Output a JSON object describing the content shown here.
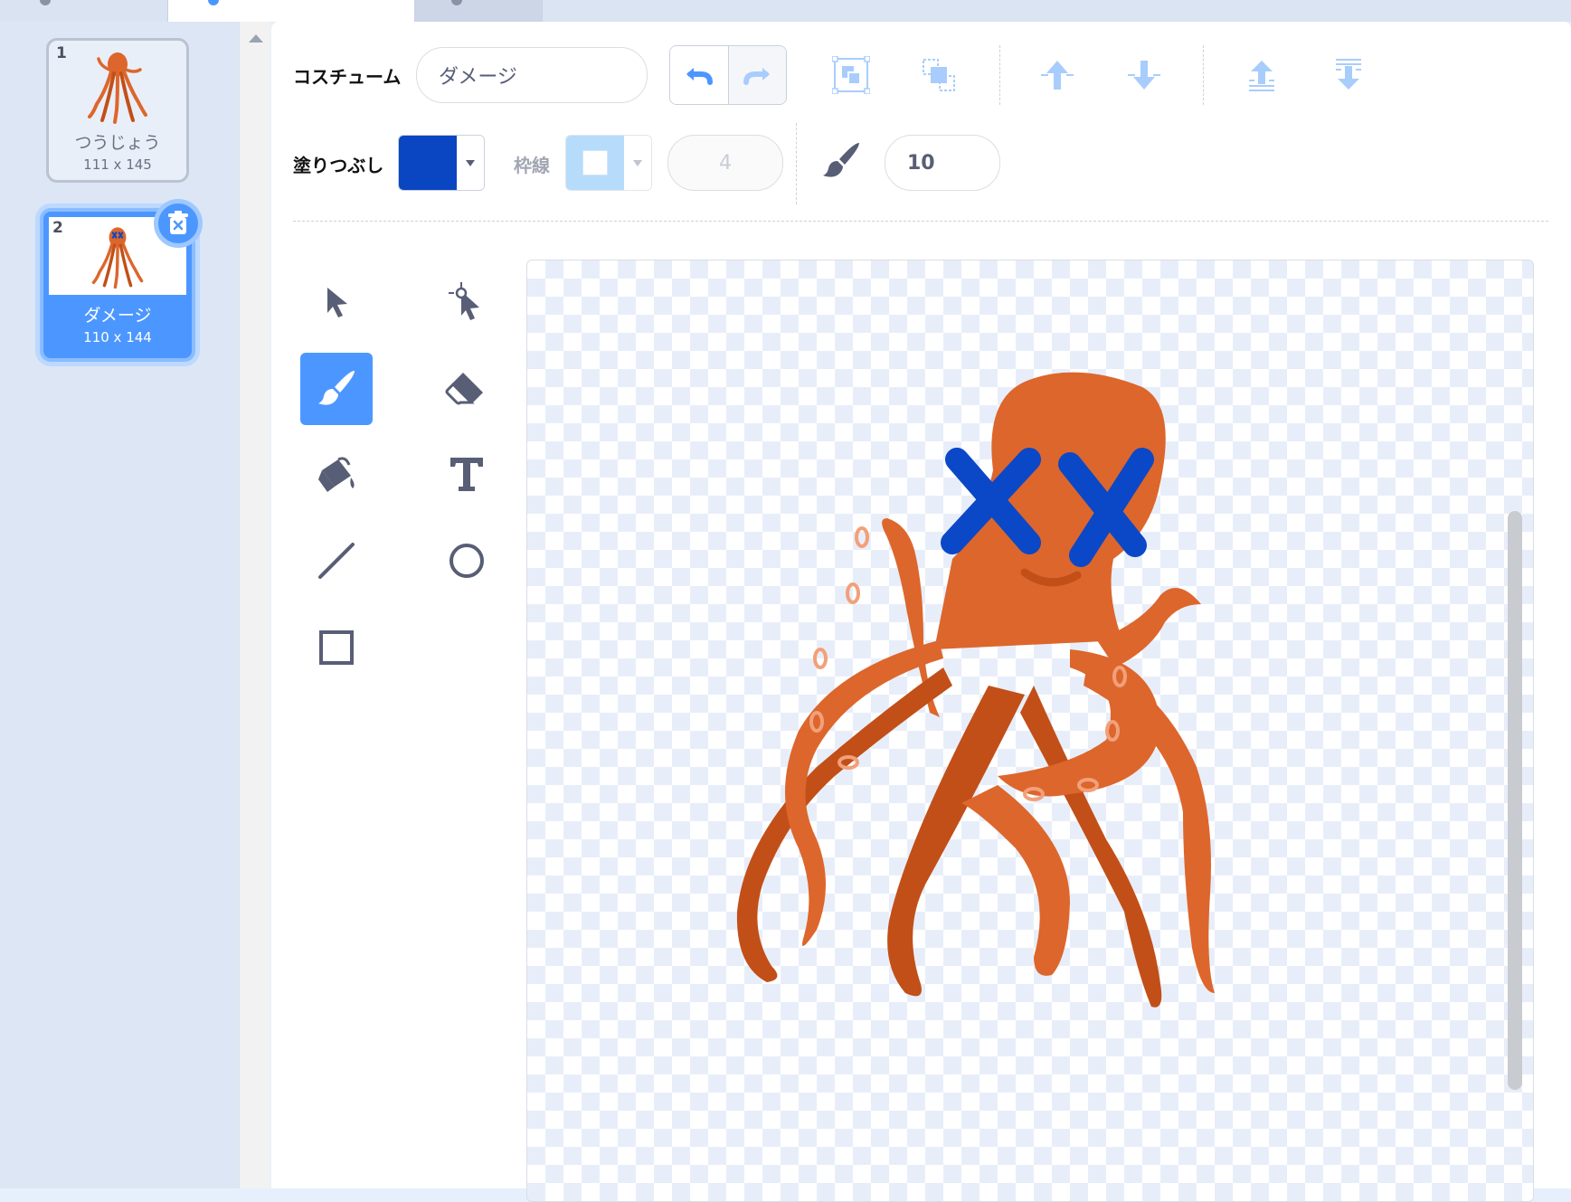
{
  "costumes": [
    {
      "number": "1",
      "name": "つうじょう",
      "size": "111 x 145"
    },
    {
      "number": "2",
      "name": "ダメージ",
      "size": "110 x 144"
    }
  ],
  "toolbar": {
    "costume_label": "コスチューム",
    "costume_name": "ダメージ",
    "fill_label": "塗りつぶし",
    "outline_label": "枠線",
    "outline_width": "4",
    "brush_size": "10"
  },
  "colors": {
    "fill": "#0b46c2",
    "outline": "#ffffff",
    "accent": "#4c97ff",
    "octopus": "#dd662c",
    "octopus_dark": "#c24f18",
    "x_marks": "#0a48c8"
  },
  "tools": [
    "select-icon",
    "reshape-icon",
    "brush-icon",
    "eraser-icon",
    "fill-icon",
    "text-icon",
    "line-icon",
    "circle-icon",
    "rectangle-icon"
  ],
  "selected_tool": "brush-icon"
}
